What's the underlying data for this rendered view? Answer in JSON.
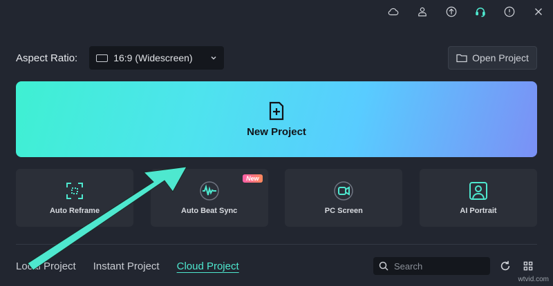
{
  "toolbar": {
    "icons": [
      "cloud-icon",
      "user-icon",
      "upload-icon",
      "headset-icon",
      "info-icon",
      "close-icon"
    ]
  },
  "aspect": {
    "label": "Aspect Ratio:",
    "value": "16:9 (Widescreen)"
  },
  "open_project": {
    "label": "Open Project"
  },
  "new_project": {
    "label": "New Project"
  },
  "cards": [
    {
      "label": "Auto Reframe",
      "icon": "reframe-icon"
    },
    {
      "label": "Auto Beat Sync",
      "icon": "beat-sync-icon",
      "badge": "New"
    },
    {
      "label": "PC Screen",
      "icon": "screen-record-icon"
    },
    {
      "label": "AI Portrait",
      "icon": "portrait-icon"
    }
  ],
  "tabs": [
    {
      "label": "Local Project"
    },
    {
      "label": "Instant Project"
    },
    {
      "label": "Cloud Project",
      "active": true
    }
  ],
  "search": {
    "placeholder": "Search"
  },
  "watermark": "wtvid.com",
  "colors": {
    "background": "#222630",
    "accent": "#4ee8cf",
    "gradient_start": "#3ff0d2",
    "gradient_end": "#7b90f5"
  }
}
